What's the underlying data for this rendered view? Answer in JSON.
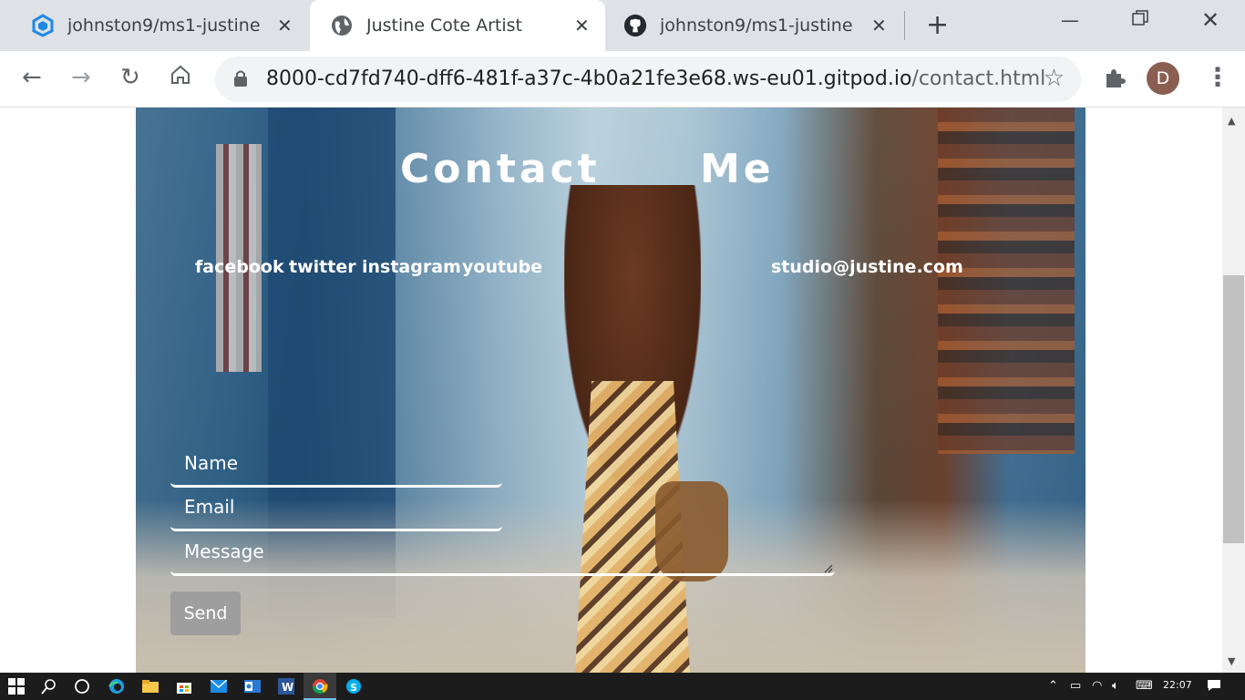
{
  "browser": {
    "tabs": [
      {
        "title": "johnston9/ms1-justine -",
        "icon": "gitpod-icon",
        "active": false
      },
      {
        "title": "Justine Cote Artist",
        "icon": "globe-icon",
        "active": true
      },
      {
        "title": "johnston9/ms1-justine",
        "icon": "github-icon",
        "active": false
      }
    ],
    "url_host": "8000-cd7fd740-dff6-481f-a37c-4b0a21fe3e68.ws-eu01.gitpod.io",
    "url_path": "/contact.html",
    "profile_initial": "D"
  },
  "page": {
    "heading_word1": "Contact",
    "heading_word2": "Me",
    "social_links": [
      "facebook",
      "twitter",
      "instagram",
      "youtube"
    ],
    "email": "studio@justine.com",
    "form": {
      "name_placeholder": "Name",
      "email_placeholder": "Email",
      "message_placeholder": "Message",
      "send_label": "Send"
    }
  },
  "taskbar": {
    "clock": "22:07"
  },
  "colors": {
    "accent_blue": "#1a73e8",
    "avatar_bg": "#8b5e52",
    "send_button": "#9e9e9e"
  }
}
